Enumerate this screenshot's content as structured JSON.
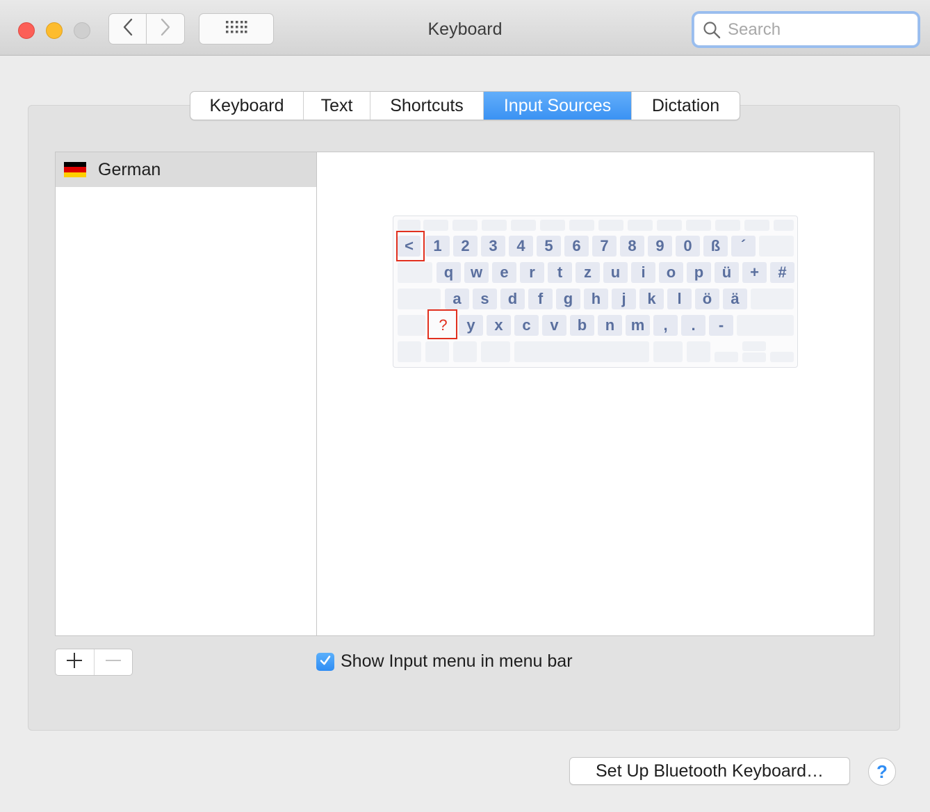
{
  "window": {
    "title": "Keyboard"
  },
  "toolbar": {
    "search_placeholder": "Search",
    "back_icon": "chevron-left-icon",
    "forward_icon": "chevron-right-icon",
    "grid_icon": "show-all-grid-icon"
  },
  "tabs": [
    {
      "label": "Keyboard",
      "active": false
    },
    {
      "label": "Text",
      "active": false
    },
    {
      "label": "Shortcuts",
      "active": false
    },
    {
      "label": "Input Sources",
      "active": true
    },
    {
      "label": "Dictation",
      "active": false
    }
  ],
  "input_sources": [
    {
      "label": "German",
      "flag": [
        "#000000",
        "#dd0000",
        "#ffce00"
      ]
    }
  ],
  "keyboard_preview": {
    "row1": [
      "<",
      "1",
      "2",
      "3",
      "4",
      "5",
      "6",
      "7",
      "8",
      "9",
      "0",
      "ß",
      "´"
    ],
    "row2": [
      "q",
      "w",
      "e",
      "r",
      "t",
      "z",
      "u",
      "i",
      "o",
      "p",
      "ü",
      "+",
      "#"
    ],
    "row3": [
      "a",
      "s",
      "d",
      "f",
      "g",
      "h",
      "j",
      "k",
      "l",
      "ö",
      "ä"
    ],
    "row4": [
      "?",
      "y",
      "x",
      "c",
      "v",
      "b",
      "n",
      "m",
      ",",
      ".",
      "-"
    ],
    "highlighted_keys": [
      "<",
      "?"
    ],
    "highlight_color": "#e1301f",
    "key_text_color": "#5a6f9e"
  },
  "controls": {
    "add_label": "+",
    "remove_label": "−",
    "show_input_menu_label": "Show Input menu in menu bar",
    "show_input_menu_checked": true,
    "bluetooth_button_label": "Set Up Bluetooth Keyboard…",
    "help_label": "?"
  },
  "colors": {
    "accent": "#3b92f3",
    "close": "#fc5f57",
    "minimize": "#fdbc2e"
  }
}
